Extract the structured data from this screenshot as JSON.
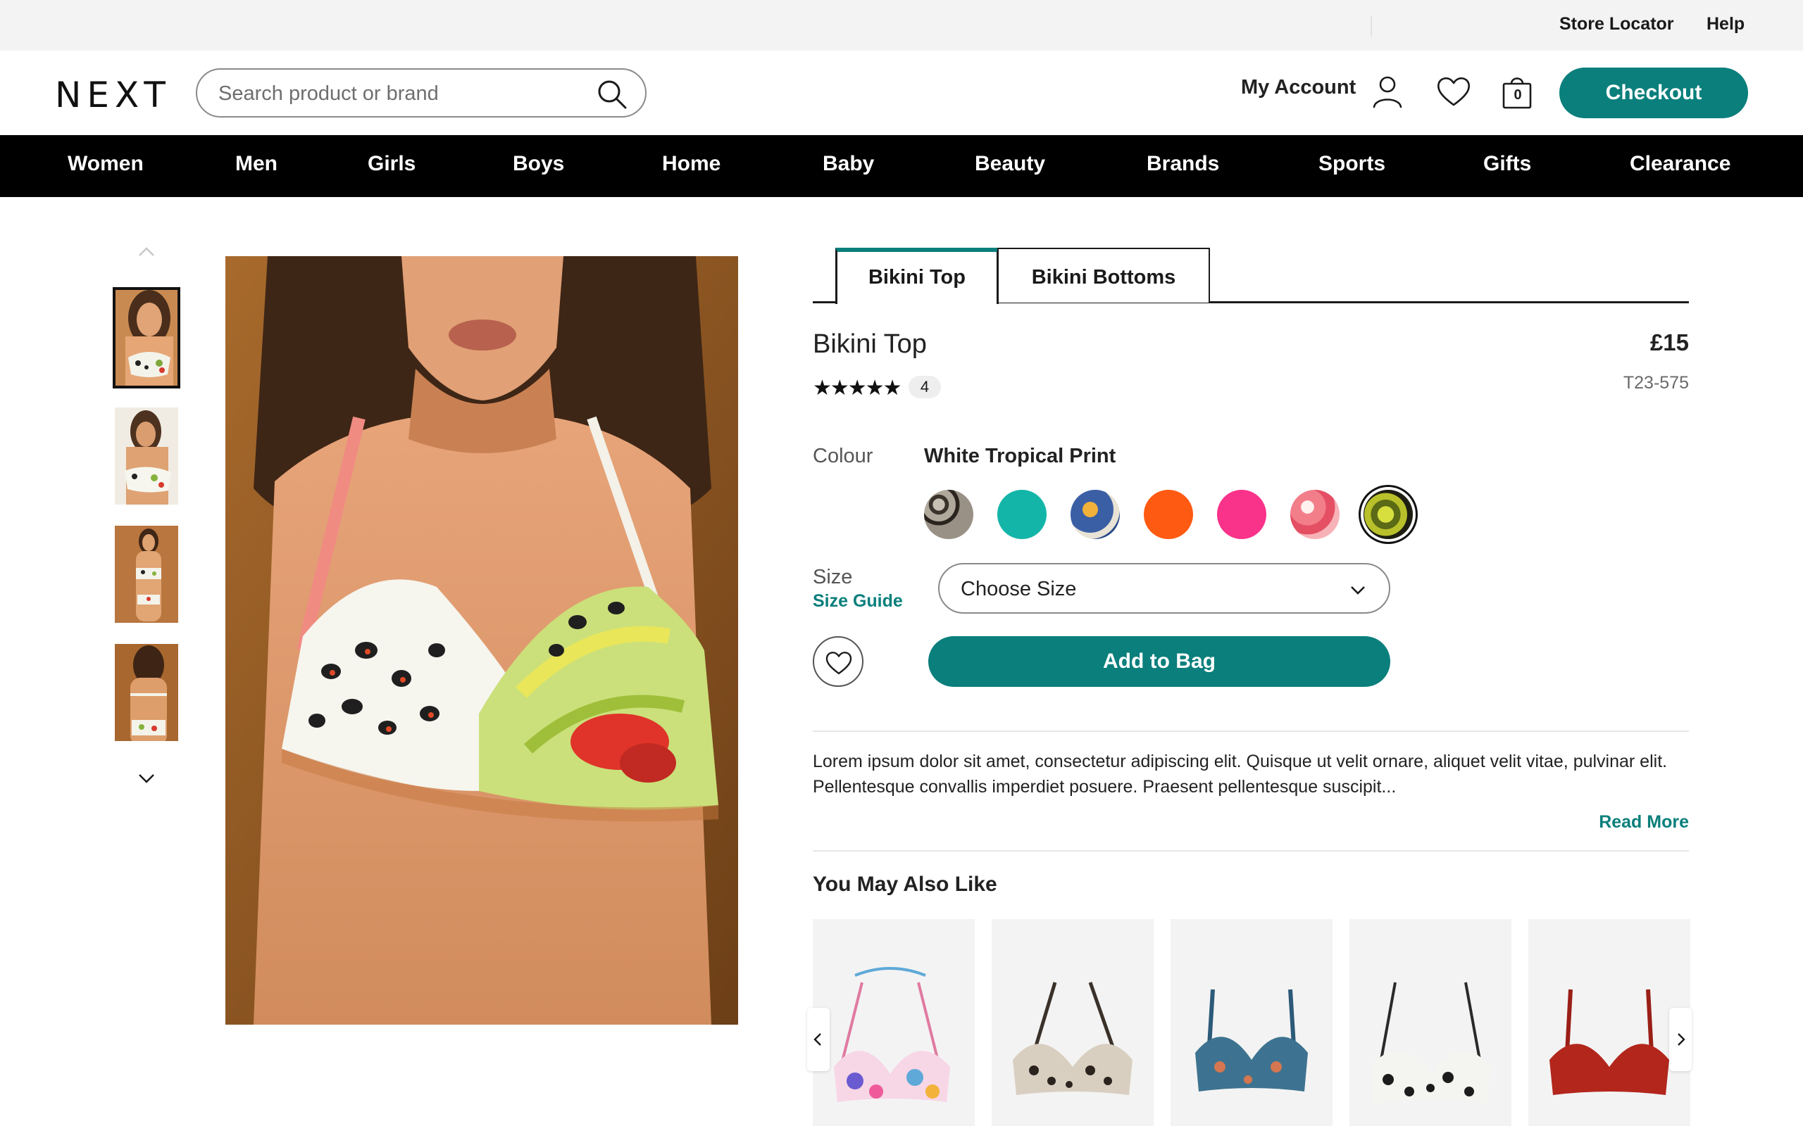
{
  "utility": {
    "store_locator": "Store Locator",
    "help": "Help"
  },
  "header": {
    "logo": "NEXT",
    "search_placeholder": "Search product or brand",
    "account_label": "My Account",
    "bag_count": "0",
    "checkout_label": "Checkout"
  },
  "nav": [
    "Women",
    "Men",
    "Girls",
    "Boys",
    "Home",
    "Baby",
    "Beauty",
    "Brands",
    "Sports",
    "Gifts",
    "Clearance"
  ],
  "product": {
    "tabs": [
      "Bikini Top",
      "Bikini Bottoms"
    ],
    "title": "Bikini Top",
    "price": "£15",
    "code": "T23-575",
    "stars": "★★★★★",
    "review_count": "4",
    "colour_label": "Colour",
    "colour_value": "White Tropical Print",
    "swatches": [
      {
        "name": "Animal Print",
        "color": "#8a8278"
      },
      {
        "name": "Teal",
        "color": "#13b5a8"
      },
      {
        "name": "Blue Print",
        "color": "#3a5fa5"
      },
      {
        "name": "Orange",
        "color": "#ff5a12"
      },
      {
        "name": "Pink",
        "color": "#f9328a"
      },
      {
        "name": "Pink Print",
        "color": "#f27e8a"
      },
      {
        "name": "White Tropical Print",
        "color": "#9da31c"
      }
    ],
    "size_label": "Size",
    "size_guide": "Size Guide",
    "size_select": "Choose Size",
    "add_to_bag": "Add to Bag",
    "description": "Lorem ipsum dolor sit amet, consectetur adipiscing elit. Quisque ut velit ornare, aliquet velit vitae, pulvinar elit. Pellentesque convallis imperdiet posuere. Praesent pellentesque suscipit...",
    "read_more": "Read More"
  },
  "also_like": {
    "title": "You May Also Like"
  },
  "colors": {
    "accent": "#0a7f7c",
    "nav_bg": "#000000",
    "utility_bg": "#f3f3f3"
  }
}
